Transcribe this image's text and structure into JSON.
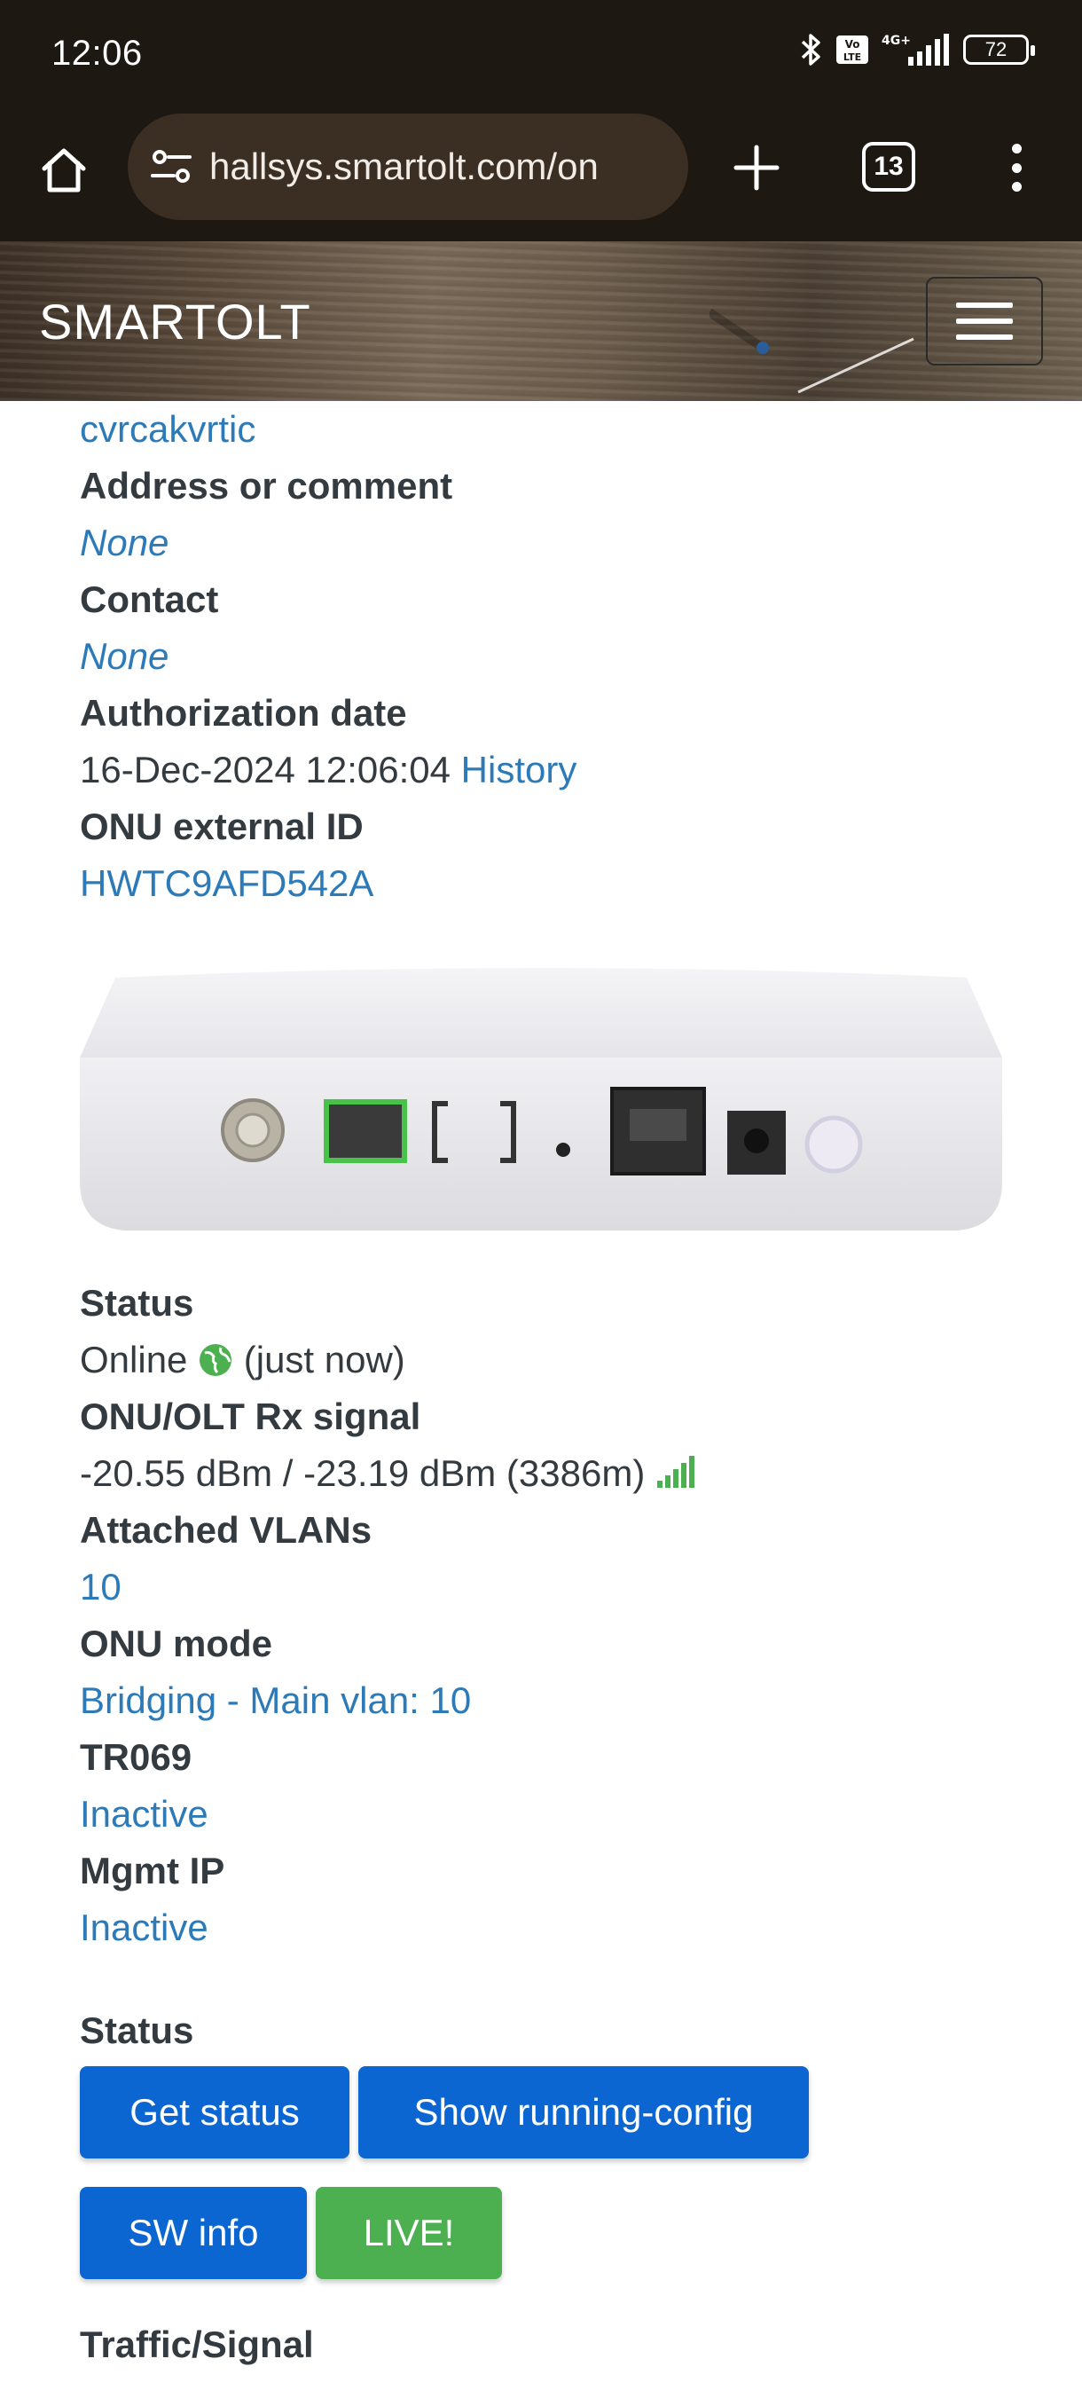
{
  "status_bar": {
    "time": "12:06",
    "network_badge": "Vo LTE",
    "network_type": "4G+",
    "battery": "72"
  },
  "browser": {
    "url": "hallsys.smartolt.com/on",
    "tab_count": "13"
  },
  "site": {
    "brand": "SMARTOLT"
  },
  "details_top": [
    {
      "kind": "value",
      "text": "cvrcakvrtic",
      "style": "link"
    },
    {
      "kind": "label",
      "text": "Address or comment"
    },
    {
      "kind": "value",
      "text": "None",
      "style": "link-italic"
    },
    {
      "kind": "label",
      "text": "Contact"
    },
    {
      "kind": "value",
      "text": "None",
      "style": "link-italic"
    },
    {
      "kind": "label",
      "text": "Authorization date"
    },
    {
      "kind": "value",
      "text": "16-Dec-2024 12:06:04",
      "link_text": "History"
    },
    {
      "kind": "label",
      "text": "ONU external ID"
    },
    {
      "kind": "value",
      "text": "HWTC9AFD542A",
      "style": "link"
    }
  ],
  "status": {
    "label": "Status",
    "value": "Online",
    "when": "(just now)"
  },
  "rx_signal": {
    "label": "ONU/OLT Rx signal",
    "value": "-20.55 dBm / -23.19 dBm (3386m)"
  },
  "vlans": {
    "label": "Attached VLANs",
    "value": "10"
  },
  "onu_mode": {
    "label": "ONU mode",
    "value": "Bridging - Main vlan: 10"
  },
  "tr069": {
    "label": "TR069",
    "value": "Inactive"
  },
  "mgmt_ip": {
    "label": "Mgmt IP",
    "value": "Inactive"
  },
  "actions": {
    "section_label": "Status",
    "get_status": "Get status",
    "show_running_config": "Show running-config",
    "sw_info": "SW info",
    "live": "LIVE!"
  },
  "traffic_section": "Traffic/Signal",
  "colors": {
    "link": "#2c7ab8",
    "button_blue": "#0c66d2",
    "button_green": "#4caf50",
    "online_green": "#4caf50"
  }
}
